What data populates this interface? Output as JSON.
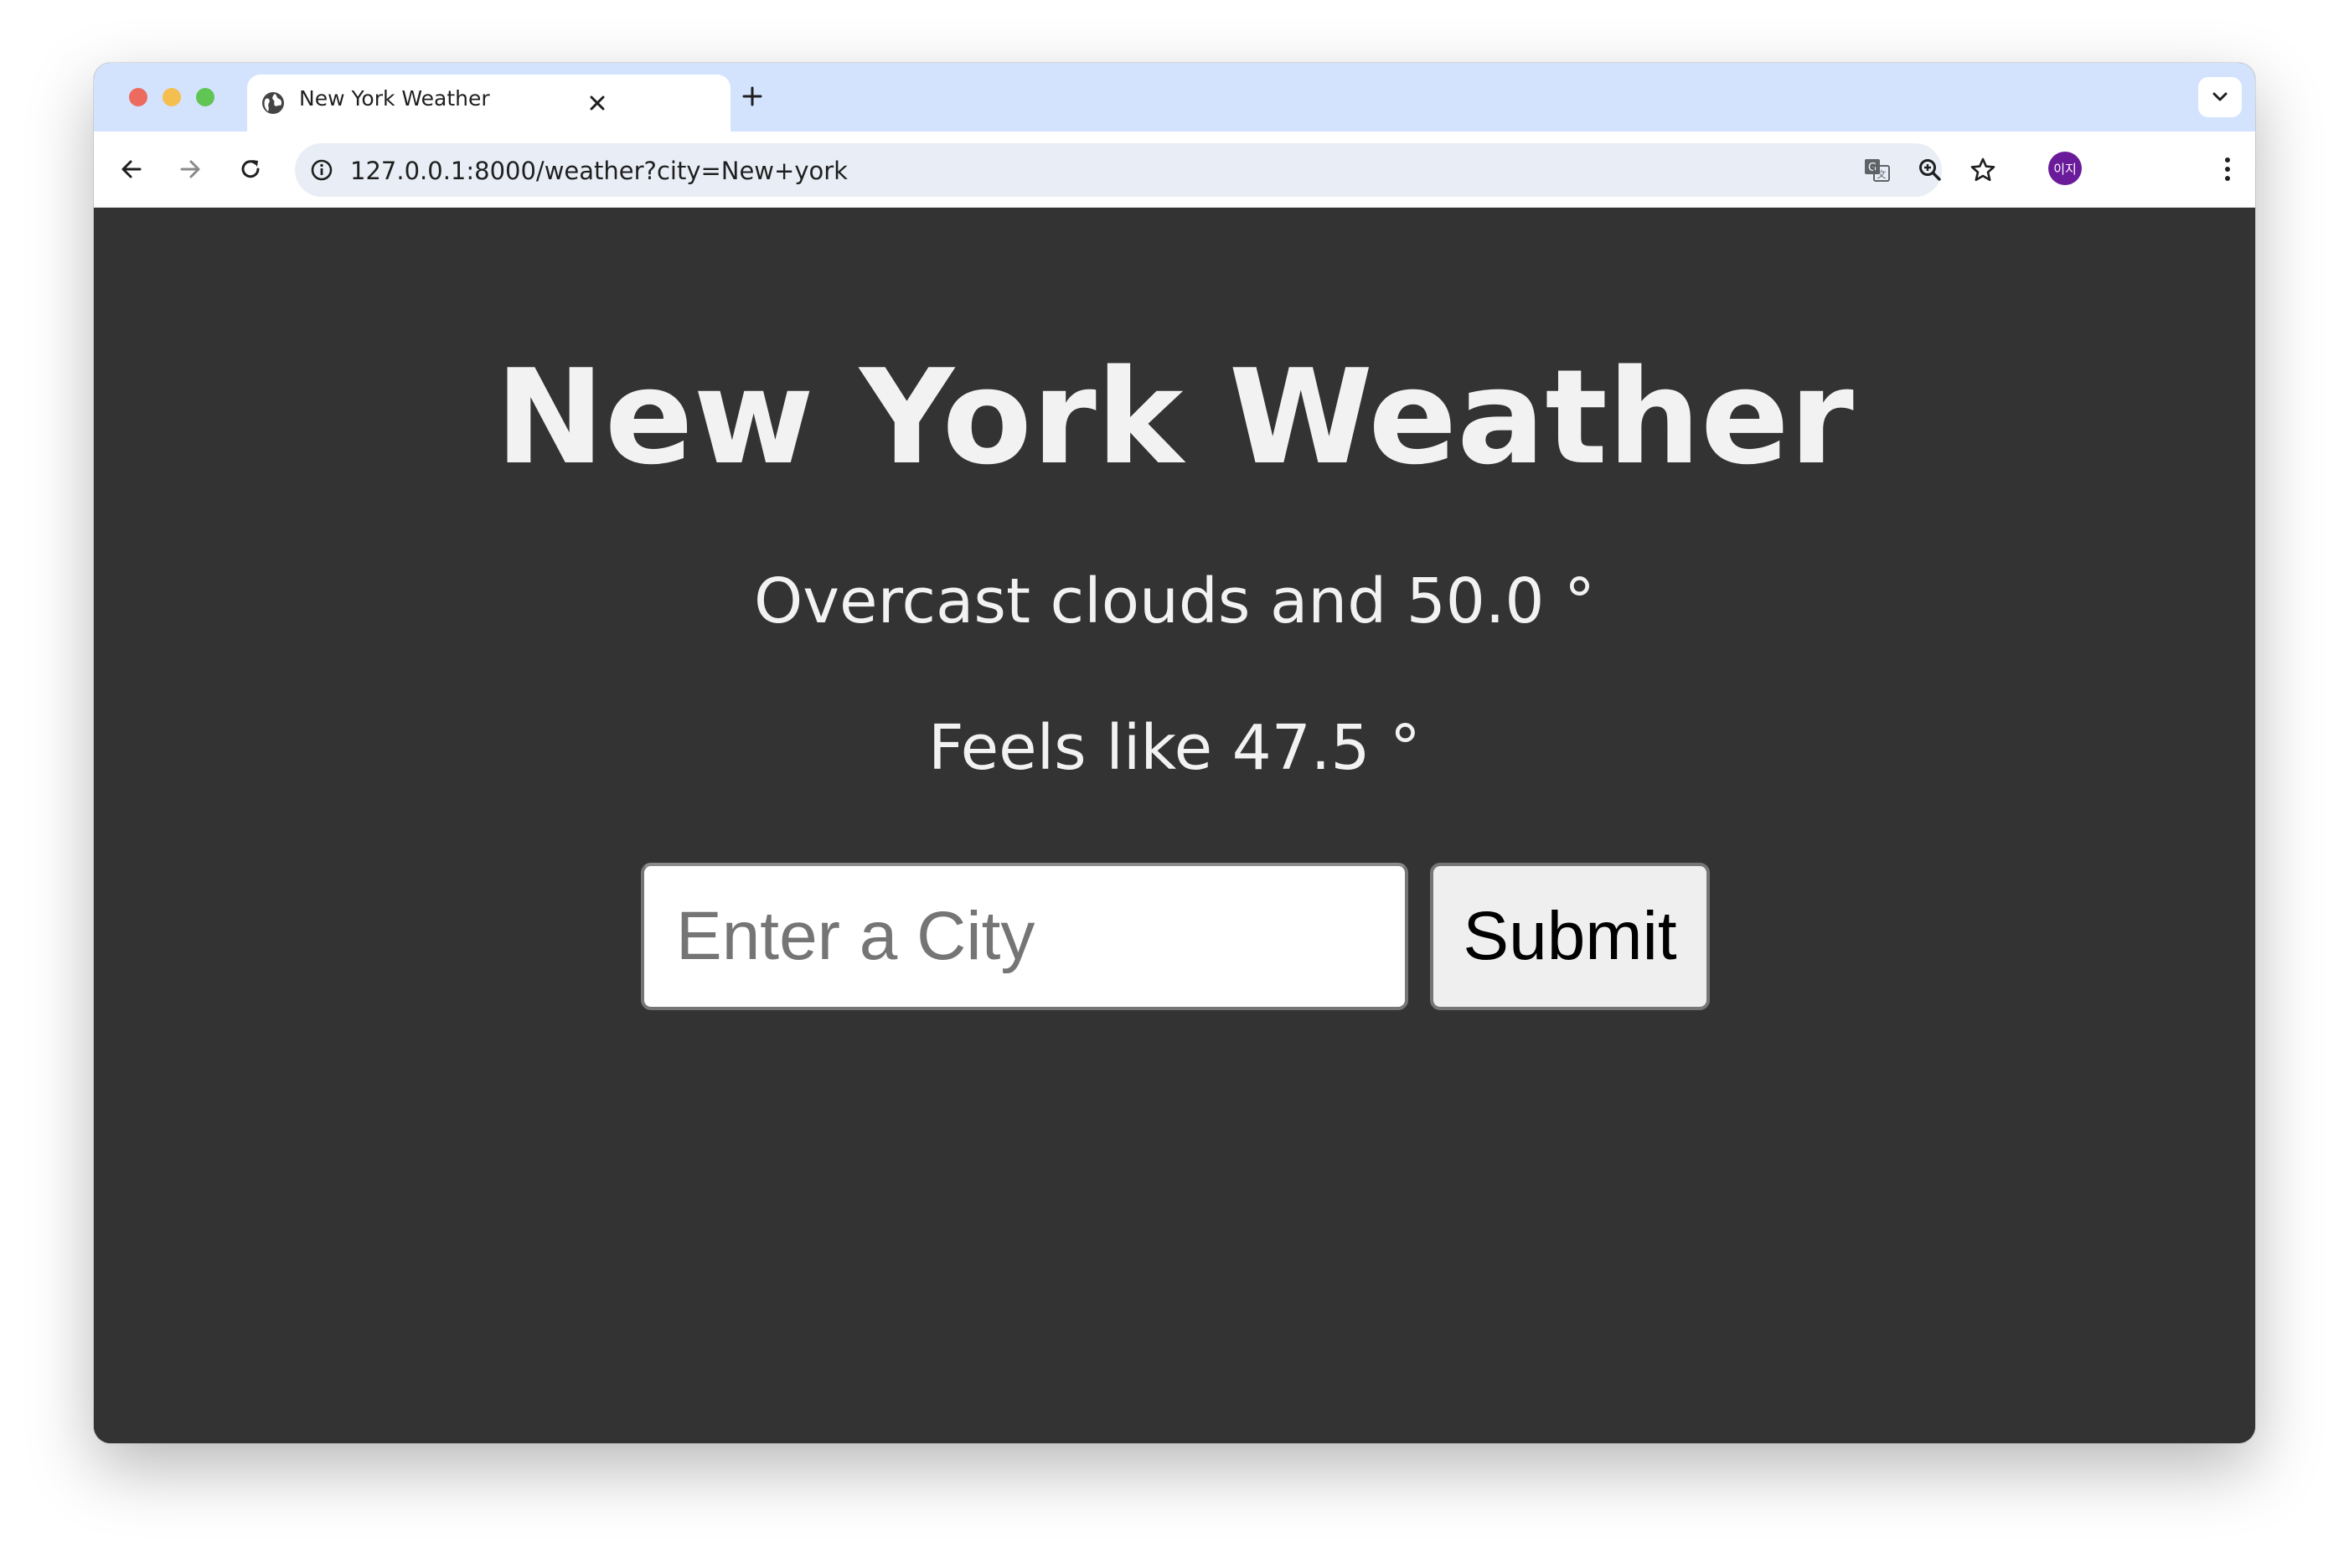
{
  "browser": {
    "tab": {
      "title": "New York Weather"
    },
    "address_bar": {
      "url": "127.0.0.1:8000/weather?city=New+york"
    },
    "profile": {
      "initials": "이지",
      "color": "#6a1b9a"
    },
    "icons": {
      "tab_favicon": "globe-icon",
      "tab_close": "close-icon",
      "new_tab": "plus-icon",
      "tab_search": "chevron-down-icon",
      "back": "arrow-left-icon",
      "forward": "arrow-right-icon",
      "reload": "reload-icon",
      "site_info": "info-icon",
      "translate": "translate-icon",
      "zoom": "zoom-icon",
      "bookmark": "star-icon",
      "menu": "kebab-menu-icon"
    }
  },
  "page": {
    "heading": "New York Weather",
    "conditions": "Overcast clouds and 50.0 °",
    "feels_like": "Feels like 47.5 °",
    "form": {
      "city_placeholder": "Enter a City",
      "city_value": "",
      "submit_label": "Submit"
    },
    "colors": {
      "background": "#333333",
      "text": "#f2f2f2"
    }
  }
}
